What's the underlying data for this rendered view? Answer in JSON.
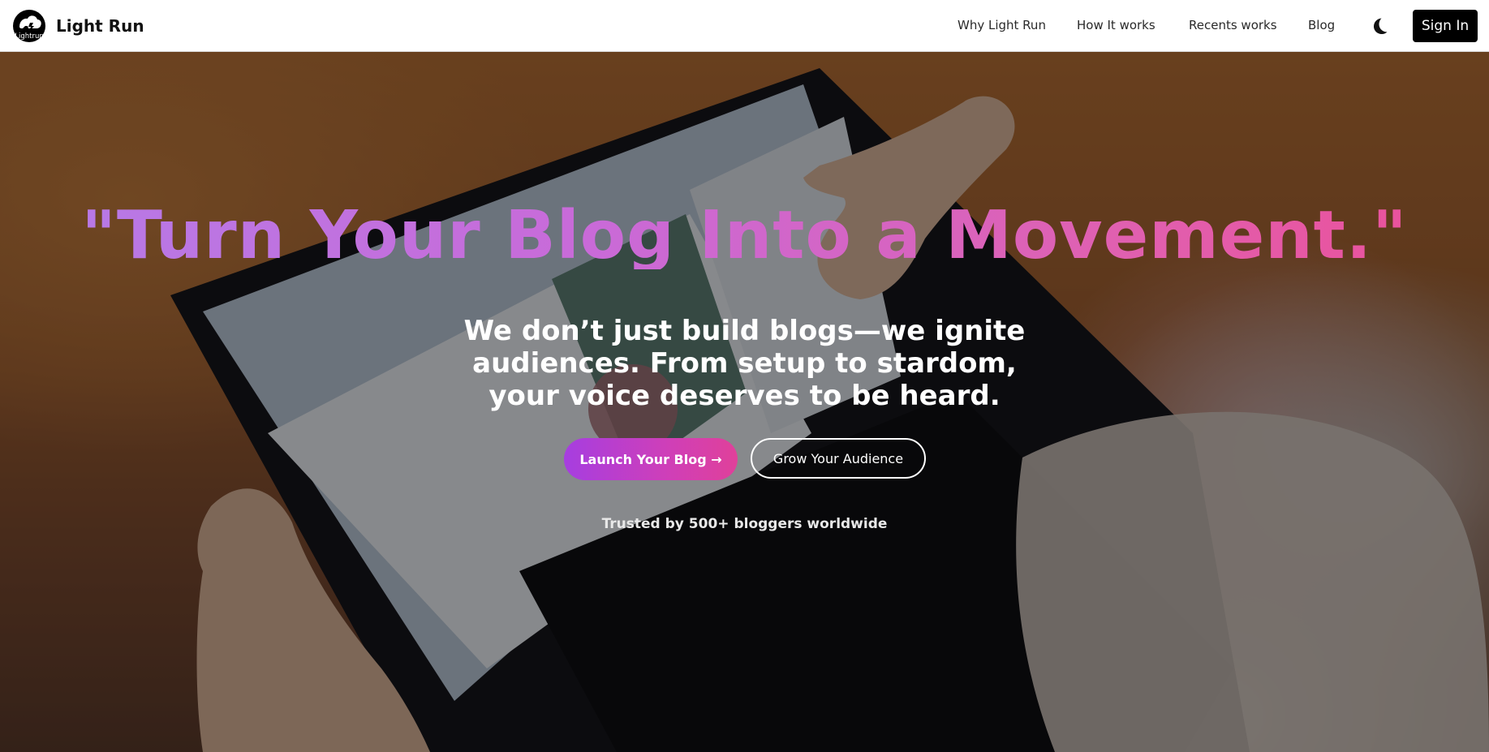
{
  "navbar": {
    "logo_text": "Lightrun",
    "brand_name": "Light Run",
    "links": [
      "Why Light Run",
      "How It works",
      "Recents works",
      "Blog"
    ],
    "theme_icon": "moon-icon",
    "sign_in_label": "Sign In"
  },
  "hero": {
    "headline": "\"Turn Your Blog Into a Movement.\"",
    "subheadline": "We don’t just build blogs—we ignite audiences. From setup to stardom, your voice deserves to be heard.",
    "primary_cta": "Launch Your Blog →",
    "secondary_cta": "Grow Your Audience",
    "trust_text": "Trusted by 500+ bloggers worldwide"
  },
  "colors": {
    "headline_gradient": [
      "#b57be8",
      "#ec4f98"
    ],
    "primary_cta_gradient": [
      "#a63ee0",
      "#e0409a"
    ],
    "nav_background": "#ffffff",
    "sign_in_background": "#000000"
  }
}
